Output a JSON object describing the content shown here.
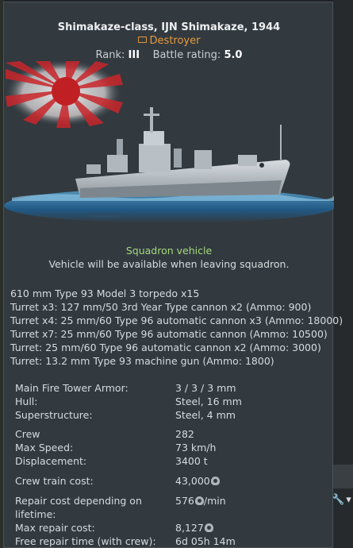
{
  "vehicle": {
    "title": "Shimakaze-class, IJN Shimakaze, 1944",
    "class_label": "Destroyer",
    "rank_label": "Rank:",
    "rank_value": "III",
    "br_label": "Battle rating:",
    "br_value": "5.0"
  },
  "squadron": {
    "title": "Squadron vehicle",
    "note": "Vehicle will be available when leaving squadron."
  },
  "weapons": [
    "610 mm Type 93 Model 3 torpedo x15",
    "Turret x3: 127 mm/50 3rd Year Type cannon x2 (Ammo: 900)",
    "Turret x4: 25 mm/60 Type 96 automatic cannon x3 (Ammo: 18000)",
    "Turret x7: 25 mm/60 Type 96 automatic cannon (Ammo: 10500)",
    "Turret: 25 mm/60 Type 96 automatic cannon x2 (Ammo: 3000)",
    "Turret: 13.2 mm Type 93 machine gun (Ammo: 1800)"
  ],
  "stats": [
    {
      "label": "Main Fire Tower Armor:",
      "value": "3 / 3 / 3 mm"
    },
    {
      "label": "Hull:",
      "value": "Steel, 16 mm"
    },
    {
      "label": "Superstructure:",
      "value": "Steel, 4 mm"
    },
    {
      "label": "Crew",
      "value": "282"
    },
    {
      "label": "Max Speed:",
      "value": "73 km/h"
    },
    {
      "label": "Displacement:",
      "value": "3400 t"
    },
    {
      "label": "Crew train cost:",
      "value": "43,000"
    },
    {
      "label": "Repair cost depending on",
      "label2": "lifetime:",
      "value": "576",
      "suffix": "/min"
    },
    {
      "label": "Max repair cost:",
      "value": "8,127"
    },
    {
      "label": "Free repair time (with crew):",
      "value": "6d 05h 14m"
    }
  ],
  "icons": {
    "class": "destroyer-tag-icon",
    "currency": "silver-lion-icon",
    "flag": "rising-sun-flag-icon"
  },
  "colors": {
    "class": "#e79a3c",
    "squadron": "#a5d87c",
    "panel": "#323a40"
  }
}
